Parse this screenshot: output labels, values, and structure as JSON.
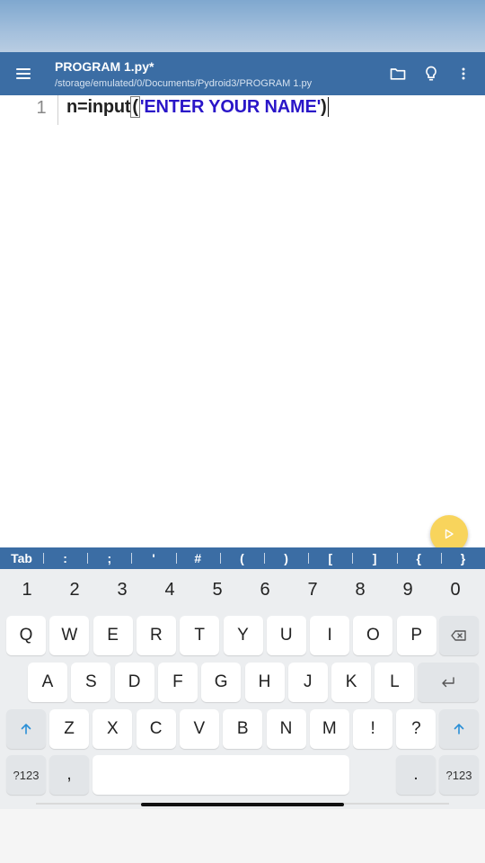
{
  "app_bar": {
    "title": "PROGRAM 1.py*",
    "path": "/storage/emulated/0/Documents/Pydroid3/PROGRAM 1.py",
    "icons": [
      "menu-icon",
      "folder-icon",
      "lightbulb-icon",
      "more-vert-icon"
    ],
    "color": "#3b6da4"
  },
  "editor": {
    "line_number": "1",
    "code": {
      "before": "n=input",
      "open_paren": "(",
      "string": "'ENTER YOUR NAME'",
      "close_paren": ")"
    },
    "string_color": "#2a16c8"
  },
  "fab": {
    "icon": "play-icon",
    "color": "#f8d45c"
  },
  "symbol_bar": {
    "keys": [
      "Tab",
      ":",
      ";",
      "'",
      "#",
      "(",
      ")",
      "[",
      "]",
      "{",
      "}"
    ]
  },
  "keyboard": {
    "numbers": [
      "1",
      "2",
      "3",
      "4",
      "5",
      "6",
      "7",
      "8",
      "9",
      "0"
    ],
    "row1": [
      "Q",
      "W",
      "E",
      "R",
      "T",
      "Y",
      "U",
      "I",
      "O",
      "P"
    ],
    "row2": [
      "A",
      "S",
      "D",
      "F",
      "G",
      "H",
      "J",
      "K",
      "L"
    ],
    "row3": [
      "Z",
      "X",
      "C",
      "V",
      "B",
      "N",
      "M",
      "!",
      "?"
    ],
    "symbols_label": "?123",
    "comma": ",",
    "period": ".",
    "symbols_label_right": "?123"
  }
}
